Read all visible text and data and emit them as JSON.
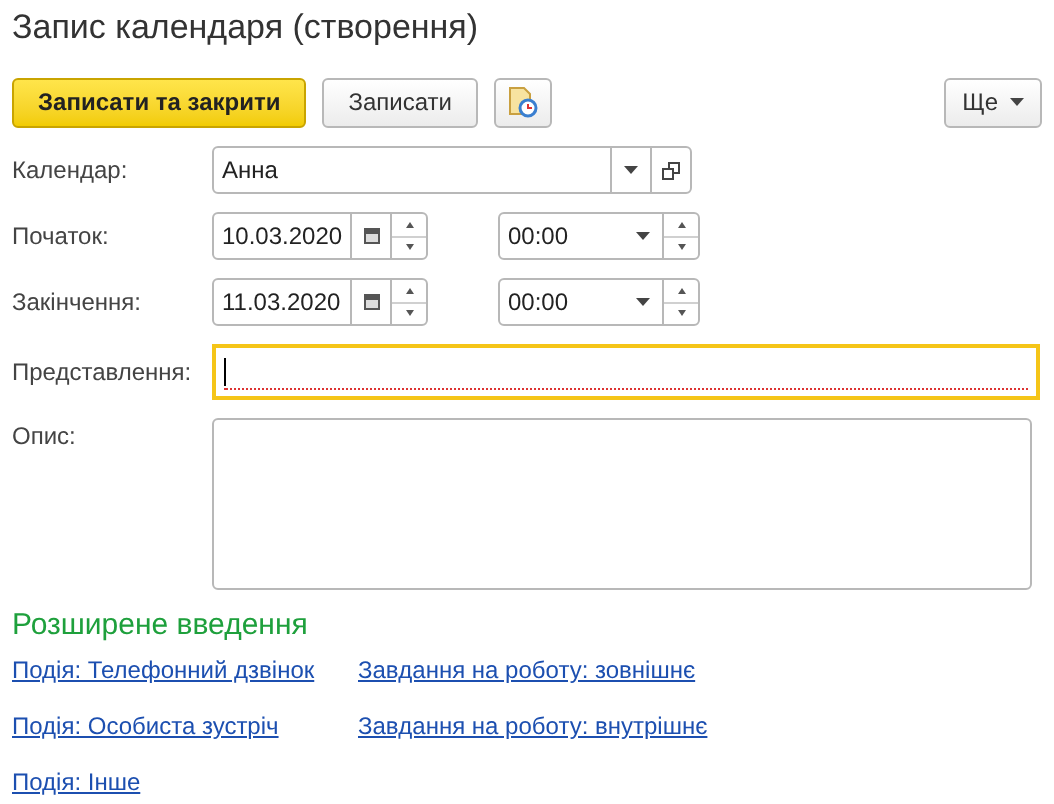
{
  "window": {
    "title": "Запис календаря (створення)"
  },
  "toolbar": [
    {
      "kind": "primary",
      "label": "Записати та закрити"
    },
    {
      "kind": "normal",
      "label": "Записати"
    },
    {
      "kind": "icon"
    },
    {
      "kind": "menu",
      "label": "Ще"
    }
  ],
  "fields": [
    {
      "kind": "choice",
      "label": "Календар:",
      "value": "Анна"
    },
    {
      "kind": "datetime",
      "label": "Початок:",
      "date": "10.03.2020",
      "time": "00:00"
    },
    {
      "kind": "datetime",
      "label": "Закінчення:",
      "date": "11.03.2020",
      "time": "00:00"
    },
    {
      "kind": "text",
      "label": "Представлення:",
      "focused": true,
      "required": true
    },
    {
      "kind": "textarea",
      "label": "Опис:"
    }
  ],
  "extended": {
    "title": "Розширене введення",
    "links": [
      [
        "Подія: Телефонний дзвінок",
        "Завдання на роботу: зовнішнє"
      ],
      [
        "Подія: Особиста зустріч",
        "Завдання на роботу: внутрішнє"
      ],
      [
        "Подія: Інше"
      ]
    ]
  }
}
